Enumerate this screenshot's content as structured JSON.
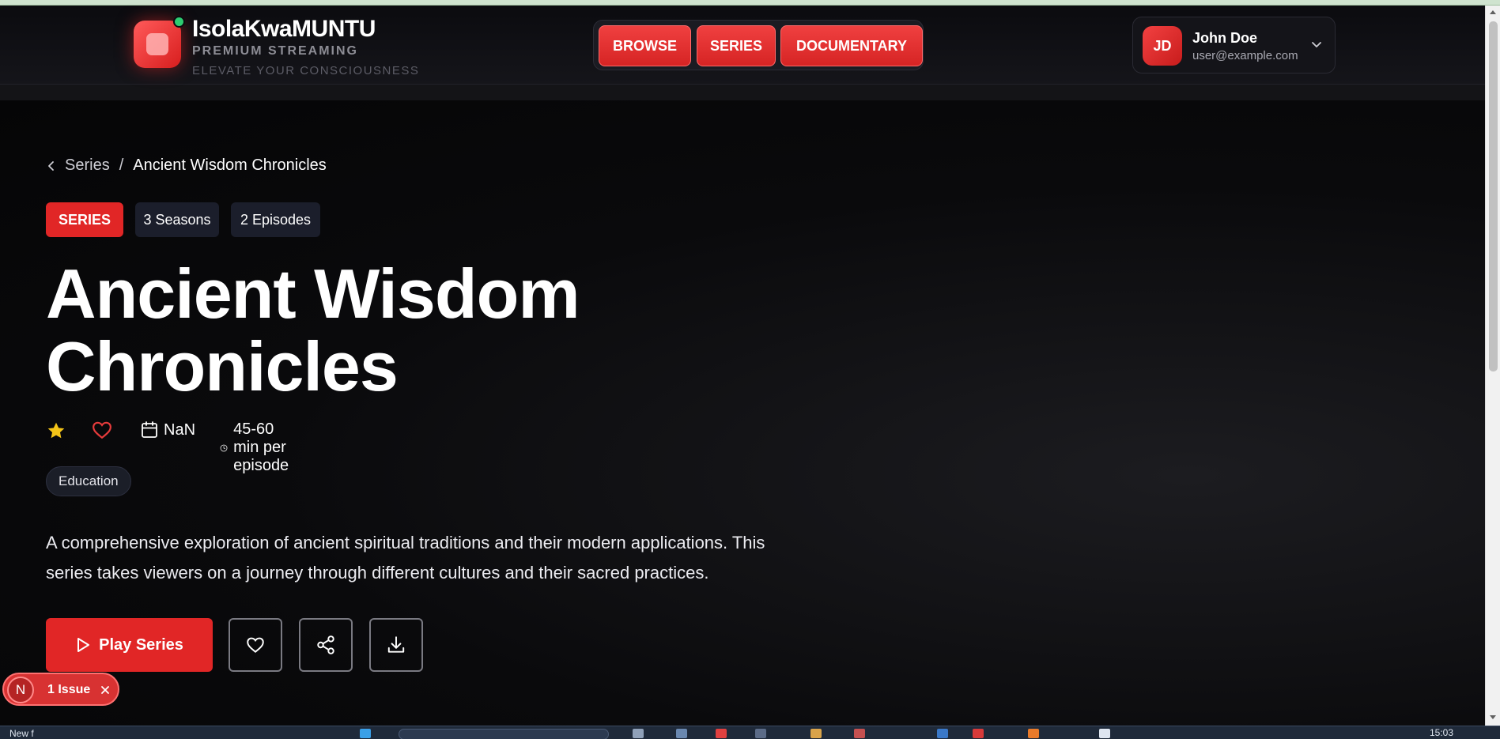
{
  "brand": {
    "name": "IsolaKwaMUNTU",
    "subtitle": "PREMIUM STREAMING",
    "tagline": "ELEVATE YOUR CONSCIOUSNESS"
  },
  "nav": {
    "items": [
      {
        "label": "BROWSE"
      },
      {
        "label": "SERIES"
      },
      {
        "label": "DOCUMENTARY"
      }
    ]
  },
  "user": {
    "initials": "JD",
    "name": "John Doe",
    "email": "user@example.com"
  },
  "breadcrumb": {
    "parent": "Series",
    "separator": "/",
    "current": "Ancient Wisdom Chronicles"
  },
  "badges": {
    "type": "SERIES",
    "seasons": "3 Seasons",
    "episodes": "2 Episodes"
  },
  "series": {
    "title_line1": "Ancient Wisdom",
    "title_line2": "Chronicles",
    "year": "NaN",
    "duration": "45-60 min per episode",
    "genre": "Education",
    "description_line1": "A comprehensive exploration of ancient spiritual traditions and their modern applications. This",
    "description_line2": "series takes viewers on a journey through different cultures and their sacred practices."
  },
  "actions": {
    "play_label": "Play Series"
  },
  "dev_overlay": {
    "badge_letter": "N",
    "issues_label": "1 Issue"
  },
  "taskbar": {
    "start_label": "New f",
    "clock": "15:03"
  },
  "colors": {
    "accent": "#e12626",
    "background": "#000000",
    "chip_bg": "#1b1e2b",
    "star": "#f5c518",
    "heart": "#e63b3b"
  },
  "icons": [
    "chevron-left-icon",
    "chevron-down-icon",
    "star-icon",
    "heart-icon",
    "calendar-icon",
    "clock-icon",
    "play-icon",
    "share-icon",
    "download-icon",
    "close-icon"
  ]
}
